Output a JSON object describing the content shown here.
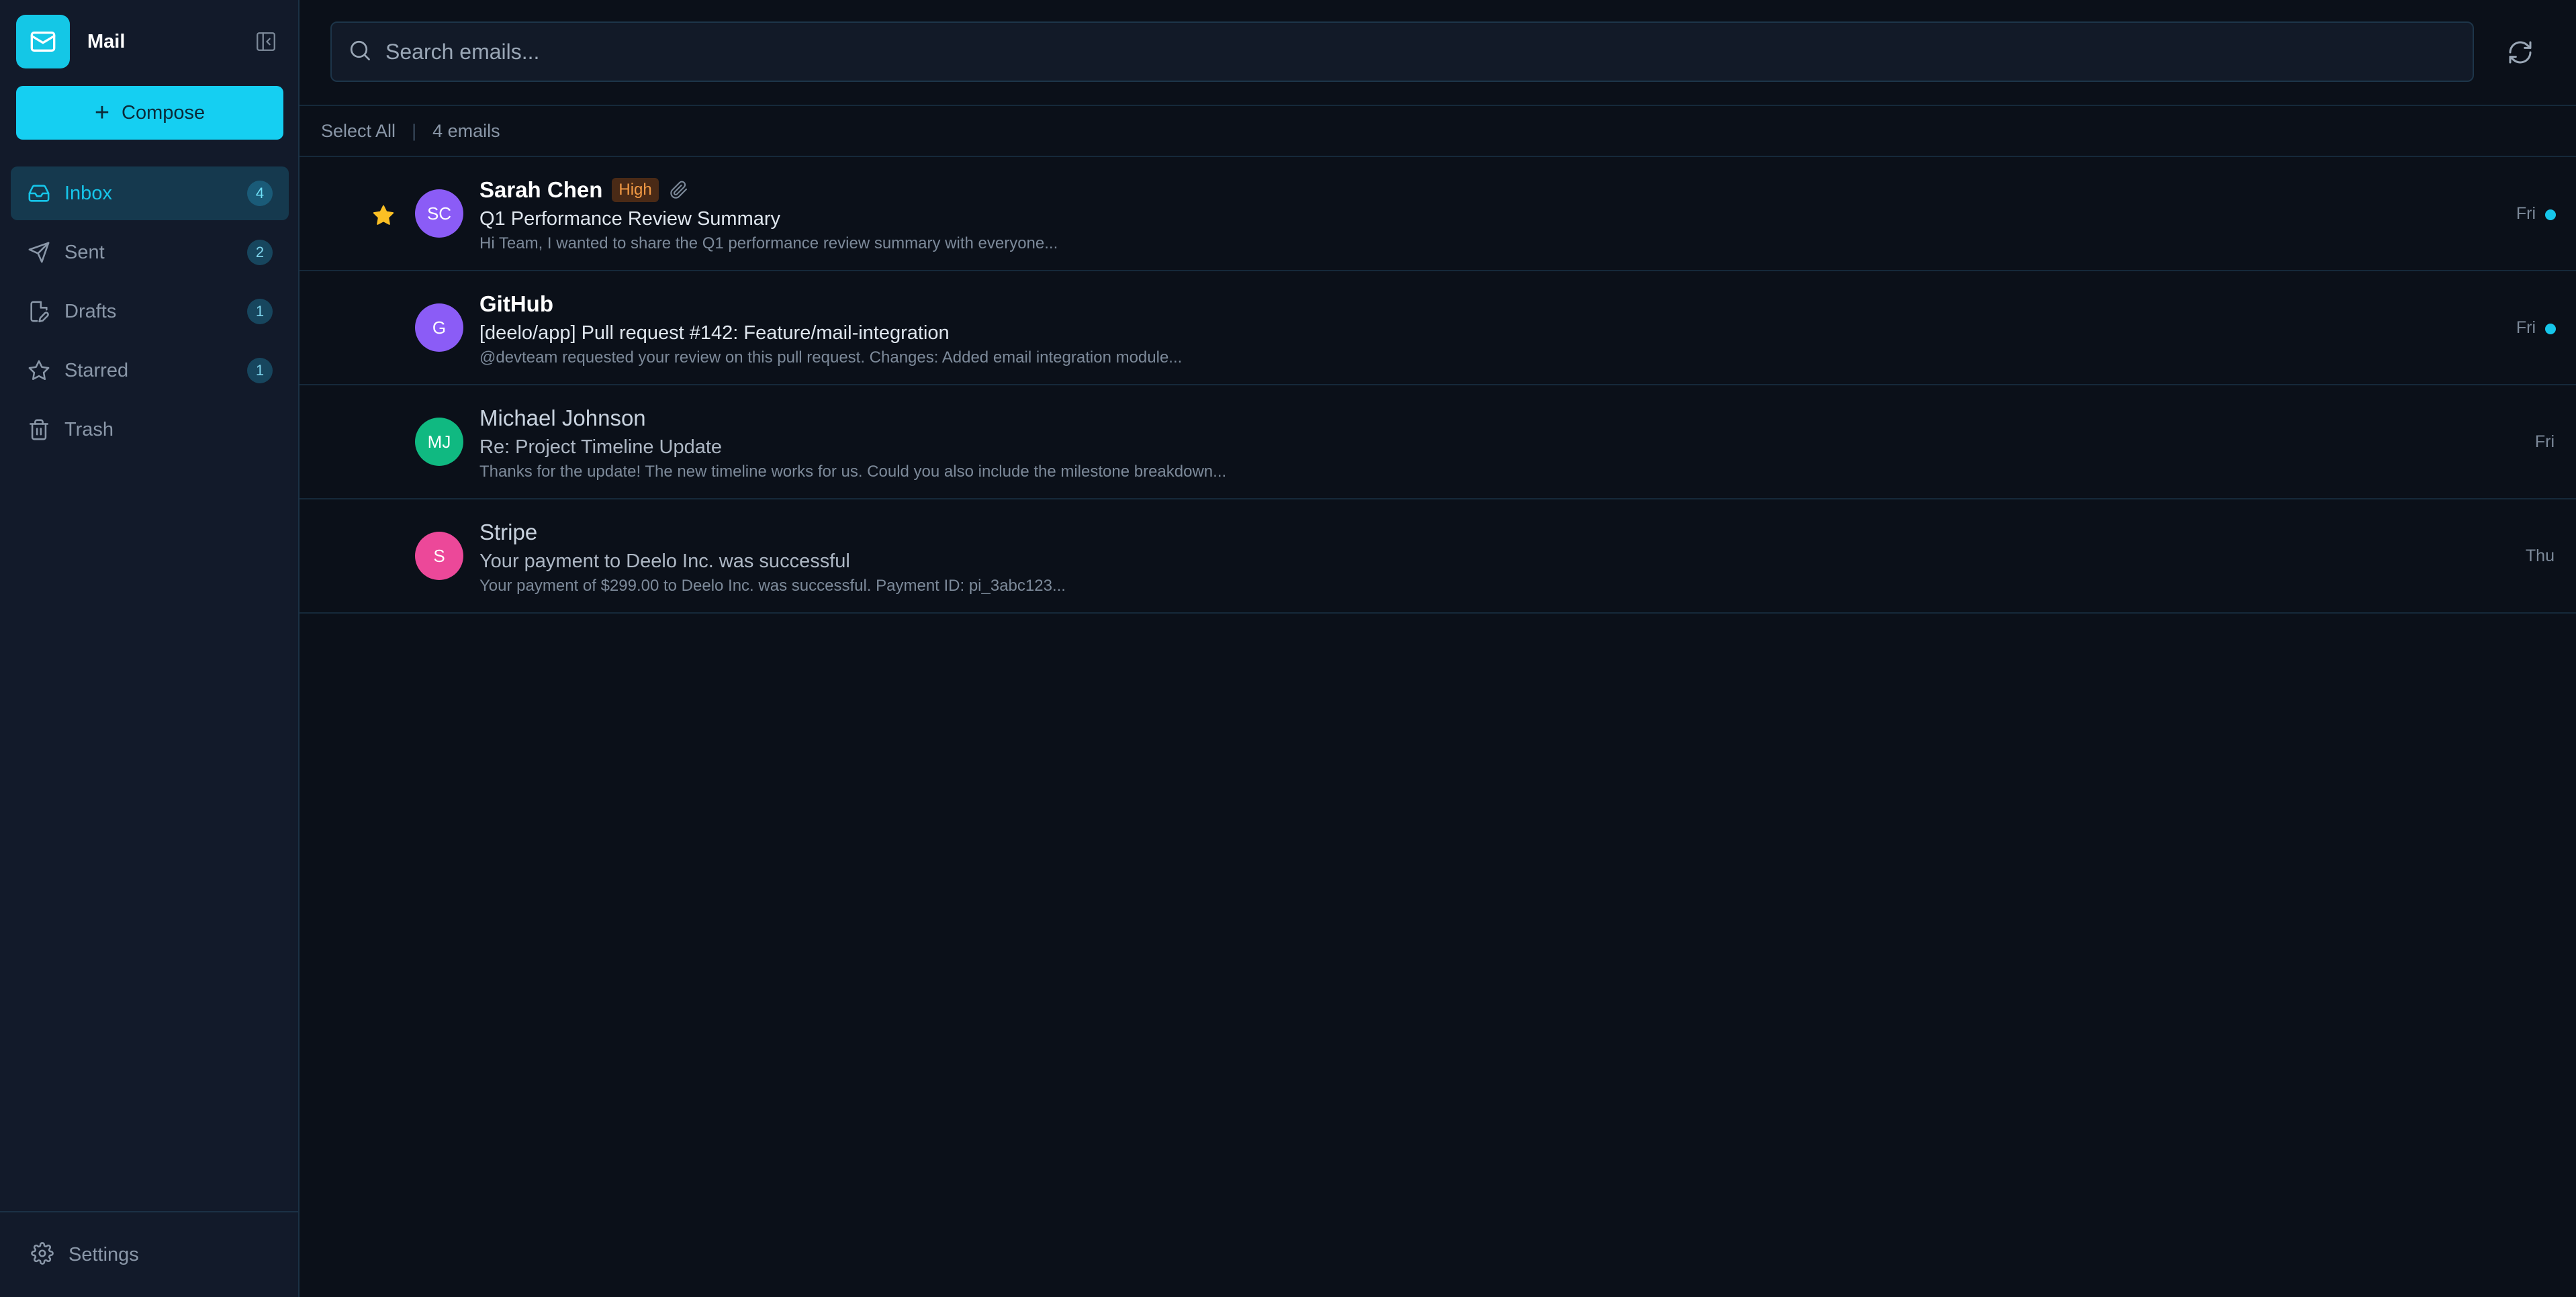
{
  "app": {
    "name": "Mail"
  },
  "compose": {
    "label": "Compose"
  },
  "nav": [
    {
      "label": "Inbox",
      "count": "4",
      "icon": "inbox-icon"
    },
    {
      "label": "Sent",
      "count": "2",
      "icon": "send-icon"
    },
    {
      "label": "Drafts",
      "count": "1",
      "icon": "file-edit-icon"
    },
    {
      "label": "Starred",
      "count": "1",
      "icon": "star-icon"
    },
    {
      "label": "Trash",
      "count": null,
      "icon": "trash-icon"
    }
  ],
  "settings": {
    "label": "Settings"
  },
  "search": {
    "placeholder": "Search emails..."
  },
  "toolbar": {
    "select_all": "Select All",
    "email_count": "4 emails"
  },
  "emails": [
    {
      "sender": "Sarah Chen",
      "initials": "SC",
      "avatar_color": "#8b5cf6",
      "priority": "High",
      "starred": true,
      "attachment": true,
      "unread": true,
      "subject": "Q1 Performance Review Summary",
      "preview": "Hi Team, I wanted to share the Q1 performance review summary with everyone...",
      "date": "Fri"
    },
    {
      "sender": "GitHub",
      "initials": "G",
      "avatar_color": "#8b5cf6",
      "starred": false,
      "attachment": false,
      "unread": true,
      "subject": "[deelo/app] Pull request #142: Feature/mail-integration",
      "preview": "@devteam requested your review on this pull request. Changes: Added email integration module...",
      "date": "Fri"
    },
    {
      "sender": "Michael Johnson",
      "initials": "MJ",
      "avatar_color": "#10b981",
      "starred": false,
      "attachment": false,
      "unread": false,
      "subject": "Re: Project Timeline Update",
      "preview": "Thanks for the update! The new timeline works for us. Could you also include the milestone breakdown...",
      "date": "Fri"
    },
    {
      "sender": "Stripe",
      "initials": "S",
      "avatar_color": "#ec4899",
      "starred": false,
      "attachment": false,
      "unread": false,
      "subject": "Your payment to Deelo Inc. was successful",
      "preview": "Your payment of $299.00 to Deelo Inc. was successful. Payment ID: pi_3abc123...",
      "date": "Thu"
    }
  ],
  "colors": {
    "accent": "#15cff2",
    "priority_bg": "#4a2a16",
    "priority_text": "#f29a45",
    "star": "#fbbf24"
  }
}
